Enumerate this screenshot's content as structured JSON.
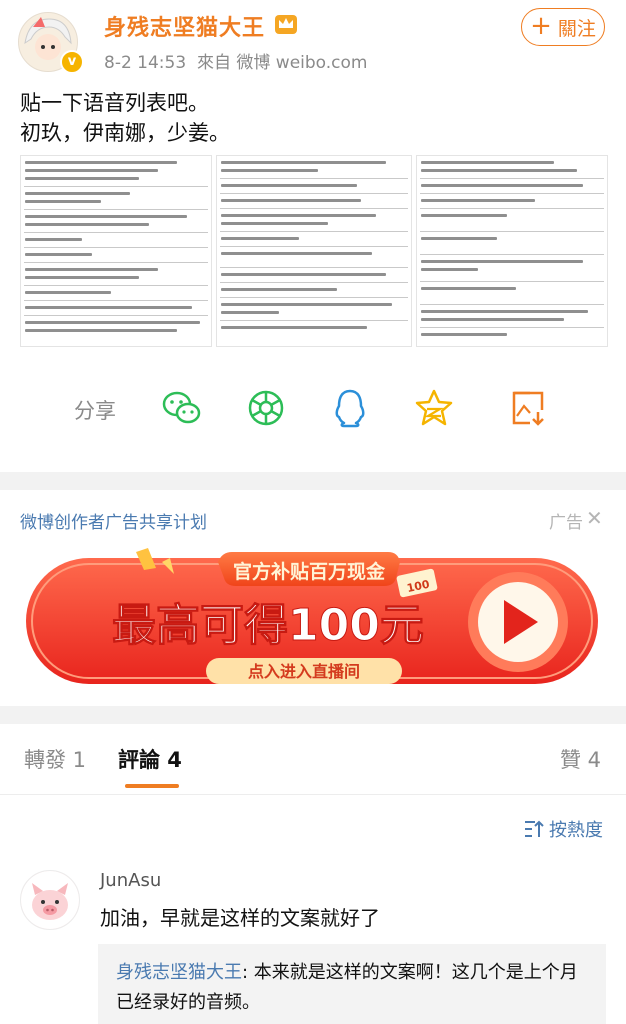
{
  "post": {
    "author": "身残志坚猫大王",
    "time": "8-2 14:53",
    "source": "來自 微博 weibo.com",
    "follow_label": "關注",
    "text": "贴一下语音列表吧。\n初玖，伊南娜，少姜。",
    "images": [
      "document-list-1",
      "document-list-2",
      "document-list-3"
    ]
  },
  "share": {
    "label": "分享",
    "targets": [
      "wechat-icon",
      "moments-icon",
      "qq-icon",
      "qzone-icon",
      "save-image-icon"
    ],
    "colors": {
      "green": "#2dbd57",
      "blue": "#2b8fd9",
      "yellow": "#f5b400",
      "orange": "#ef7d22"
    }
  },
  "ad": {
    "title": "微博创作者广告共享计划",
    "tag": "广告",
    "banner_top": "官方补贴百万现金",
    "banner_main": "最高可得100元",
    "banner_bottom": "点入进入直播间",
    "sticker": "100"
  },
  "tabs": {
    "repost": "轉發 1",
    "comment": "評論 4",
    "like": "贊 4"
  },
  "sort_label": "按熱度",
  "comments": [
    {
      "user": "JunAsu",
      "text": "加油，早就是这样的文案就好了",
      "reply": {
        "user": "身残志坚猫大王",
        "text": ": 本来就是这样的文案啊！这几个是上个月已经录好的音频。"
      }
    }
  ]
}
